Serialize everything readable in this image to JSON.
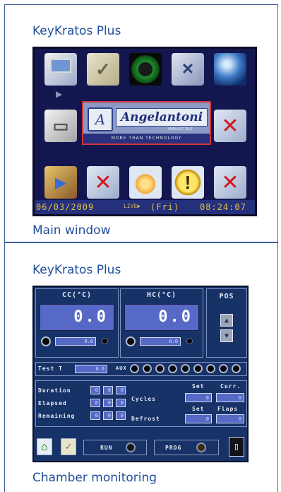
{
  "sections": [
    {
      "title": "KeyKratos Plus",
      "caption": "Main window"
    },
    {
      "title": "KeyKratos Plus",
      "caption": "Chamber monitoring"
    }
  ],
  "main_window": {
    "icons_row1": [
      "monitor-icon",
      "notepad-icon",
      "power-icon",
      "tools-icon",
      "globe-icon"
    ],
    "icons_row2": [
      "printer-icon",
      "close-icon"
    ],
    "icons_row3": [
      "video-icon",
      "close-icon",
      "sun-icon",
      "warning-icon",
      "close-icon"
    ],
    "logo": {
      "brand": "Angelantoni",
      "subtitle": "INDUSTRIE",
      "tagline": "MORE THAN TECHNOLOGY"
    },
    "status_bar": {
      "date": "06/03/2009",
      "live": "LIVE",
      "day": "(Fri)",
      "time": "08:24:07"
    },
    "accent_color": "#e3c23f"
  },
  "chamber": {
    "cc_label": "CC(°C)",
    "hc_label": "HC(°C)",
    "pos_label": "POS",
    "cc_value": "0.0",
    "hc_value": "0.0",
    "cc_sub_value": "0.0",
    "hc_sub_value": "0.0",
    "test_label": "Test T",
    "test_value": "0.0",
    "aux_label": "AUX",
    "duration_label": "Duration",
    "elapsed_label": "Elapsed",
    "remaining_label": "Remaining",
    "cycles_label": "Cycles",
    "set_label": "Set",
    "curr_label": "Curr.",
    "flaps_label": "Flaps",
    "defrost_label": "Defrost",
    "time_value": "0",
    "cycles_set": "0",
    "cycles_curr": "0",
    "set_value": "0",
    "flaps_value": "0",
    "run_label": "RUN",
    "prog_label": "PROG",
    "aux_led_count": 9
  }
}
